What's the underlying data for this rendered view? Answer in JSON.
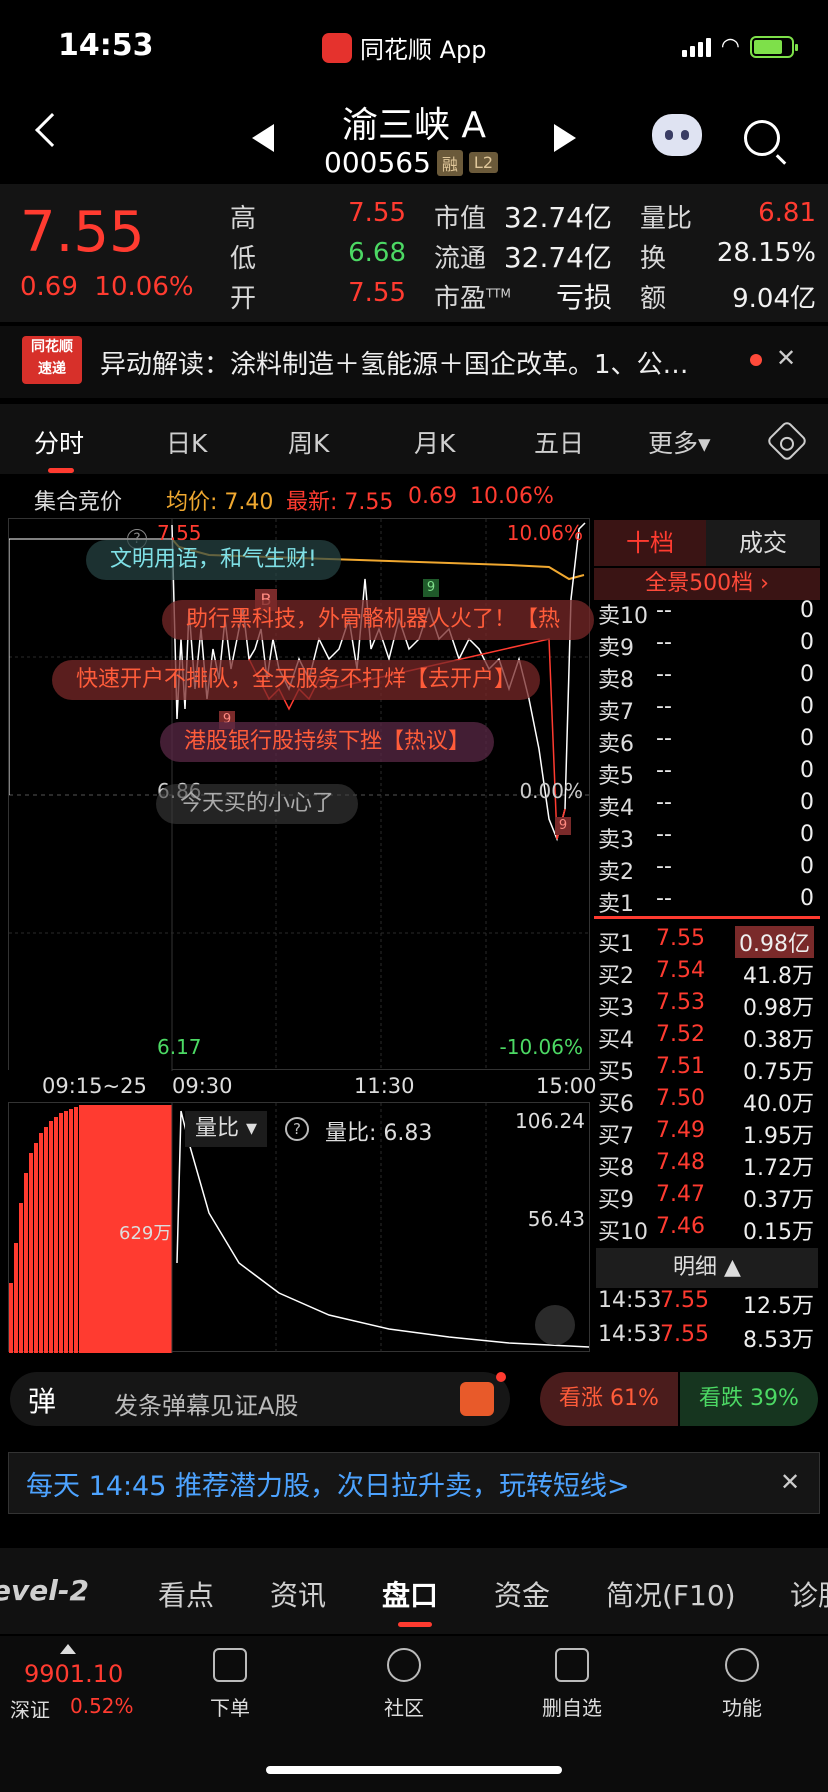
{
  "status_bar": {
    "time": "14:53",
    "app_name": "同花顺 App"
  },
  "header": {
    "stock_name": "渝三峡 A",
    "stock_code": "000565",
    "tag_margin": "融",
    "tag_level": "L2"
  },
  "quote": {
    "price": "7.55",
    "change": "0.69",
    "change_pct": "10.06%",
    "high_label": "高",
    "high": "7.55",
    "low_label": "低",
    "low": "6.68",
    "open_label": "开",
    "open": "7.55",
    "mktcap_label": "市值",
    "mktcap": "32.74亿",
    "float_label": "流通",
    "float": "32.74亿",
    "pe_label": "市盈",
    "pe_sup": "TTM",
    "pe": "亏损",
    "vr_label": "量比",
    "vr": "6.81",
    "turnover_label": "换",
    "turnover": "28.15%",
    "amount_label": "额",
    "amount": "9.04亿"
  },
  "news": {
    "logo_top": "同花顺",
    "logo_bottom": "速递",
    "text": "异动解读：涂料制造＋氢能源＋国企改革。1、公…"
  },
  "tabs": [
    "分时",
    "日K",
    "周K",
    "月K",
    "五日",
    "更多▾"
  ],
  "info_line": {
    "auction": "集合竞价",
    "avg": "均价: 7.40",
    "latest": "最新: 7.55",
    "chg": "0.69",
    "pct": "10.06%"
  },
  "chart": {
    "y_top": "7.55",
    "y_top_pct": "10.06%",
    "y_mid": "6.86",
    "y_mid_pct": "0.00%",
    "y_bot": "6.17",
    "y_bot_pct": "-10.06%",
    "x_labels": [
      "09:15~25",
      "09:30",
      "11:30",
      "15:00"
    ],
    "marker_b": "B",
    "marker_9": "9",
    "lower_indicator": "量比",
    "lower_value": "量比: 6.83",
    "lower_y_top": "106.24",
    "lower_y_mid": "56.43",
    "auction_vol": "629万"
  },
  "danmu": [
    "文明用语，和气生财!",
    "助行黑科技，外骨骼机器人火了！【热",
    "快速开户不排队，全天服务不打烊【去开户】",
    "港股银行股持续下挫【热议】",
    "今天买的小心了"
  ],
  "orderbook": {
    "tab_active": "十档",
    "tab_other": "成交",
    "full_depth": "全景500档 ›",
    "asks": [
      {
        "label": "卖10",
        "price": "--",
        "vol": "0"
      },
      {
        "label": "卖9",
        "price": "--",
        "vol": "0"
      },
      {
        "label": "卖8",
        "price": "--",
        "vol": "0"
      },
      {
        "label": "卖7",
        "price": "--",
        "vol": "0"
      },
      {
        "label": "卖6",
        "price": "--",
        "vol": "0"
      },
      {
        "label": "卖5",
        "price": "--",
        "vol": "0"
      },
      {
        "label": "卖4",
        "price": "--",
        "vol": "0"
      },
      {
        "label": "卖3",
        "price": "--",
        "vol": "0"
      },
      {
        "label": "卖2",
        "price": "--",
        "vol": "0"
      },
      {
        "label": "卖1",
        "price": "--",
        "vol": "0"
      }
    ],
    "bids": [
      {
        "label": "买1",
        "price": "7.55",
        "vol": "0.98亿"
      },
      {
        "label": "买2",
        "price": "7.54",
        "vol": "41.8万"
      },
      {
        "label": "买3",
        "price": "7.53",
        "vol": "0.98万"
      },
      {
        "label": "买4",
        "price": "7.52",
        "vol": "0.38万"
      },
      {
        "label": "买5",
        "price": "7.51",
        "vol": "0.75万"
      },
      {
        "label": "买6",
        "price": "7.50",
        "vol": "40.0万"
      },
      {
        "label": "买7",
        "price": "7.49",
        "vol": "1.95万"
      },
      {
        "label": "买8",
        "price": "7.48",
        "vol": "1.72万"
      },
      {
        "label": "买9",
        "price": "7.47",
        "vol": "0.37万"
      },
      {
        "label": "买10",
        "price": "7.46",
        "vol": "0.15万"
      }
    ],
    "detail_label": "明细 ▲",
    "trades": [
      {
        "time": "14:53",
        "price": "7.55",
        "vol": "12.5万"
      },
      {
        "time": "14:53",
        "price": "7.55",
        "vol": "8.53万"
      }
    ]
  },
  "bottom": {
    "danmu_icon": "弹",
    "danmu_placeholder": "发条弹幕见证A股",
    "bullish": "看涨 61%",
    "bearish": "看跌 39%",
    "promo": "每天 14:45 推荐潜力股，次日拉升卖，玩转短线>",
    "sub_tabs": [
      "evel-2",
      "看点",
      "资讯",
      "盘口",
      "资金",
      "简况(F10)",
      "诊股"
    ],
    "index_value": "9901.10",
    "index_name": "深证",
    "index_pct": "0.52%",
    "nav": [
      "下单",
      "社区",
      "删自选",
      "功能"
    ]
  },
  "colors": {
    "up": "#ff3b30",
    "down": "#4cd964",
    "avg_line": "#f0a830",
    "price_line": "#ffffff"
  }
}
